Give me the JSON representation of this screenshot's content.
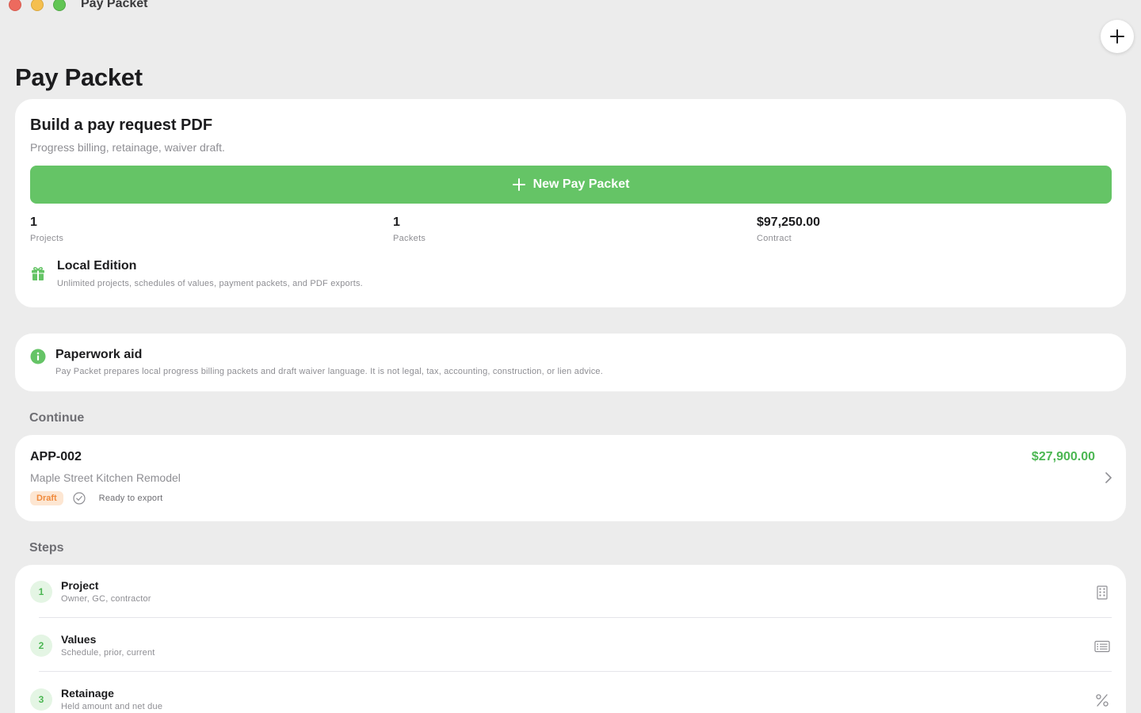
{
  "window": {
    "title": "Pay Packet"
  },
  "header": {
    "page_title": "Pay Packet"
  },
  "build": {
    "title": "Build a pay request PDF",
    "subtitle": "Progress billing, retainage, waiver draft.",
    "new_button_label": "New Pay Packet",
    "stats": [
      {
        "value": "1",
        "label": "Projects"
      },
      {
        "value": "1",
        "label": "Packets"
      },
      {
        "value": "$97,250.00",
        "label": "Contract"
      }
    ],
    "edition": {
      "icon": "gift-icon",
      "title": "Local Edition",
      "description": "Unlimited projects, schedules of values, payment packets, and PDF exports."
    }
  },
  "aid": {
    "icon": "info-icon",
    "title": "Paperwork aid",
    "description": "Pay Packet prepares local progress billing packets and draft waiver language. It is not legal, tax, accounting, construction, or lien advice."
  },
  "continue": {
    "header": "Continue",
    "item": {
      "id": "APP-002",
      "amount": "$27,900.00",
      "project": "Maple Street Kitchen Remodel",
      "status_badge": "Draft",
      "ready_text": "Ready to export"
    }
  },
  "steps": {
    "header": "Steps",
    "items": [
      {
        "number": "1",
        "title": "Project",
        "description": "Owner, GC, contractor",
        "icon": "building-icon"
      },
      {
        "number": "2",
        "title": "Values",
        "description": "Schedule, prior, current",
        "icon": "list-icon"
      },
      {
        "number": "3",
        "title": "Retainage",
        "description": "Held amount and net due",
        "icon": "percent-icon"
      }
    ]
  },
  "colors": {
    "accent": "#65c466",
    "accent_text": "#4cb753",
    "draft_badge_bg": "#fde6d2",
    "draft_badge_text": "#f08a3c",
    "background": "#ececec"
  }
}
